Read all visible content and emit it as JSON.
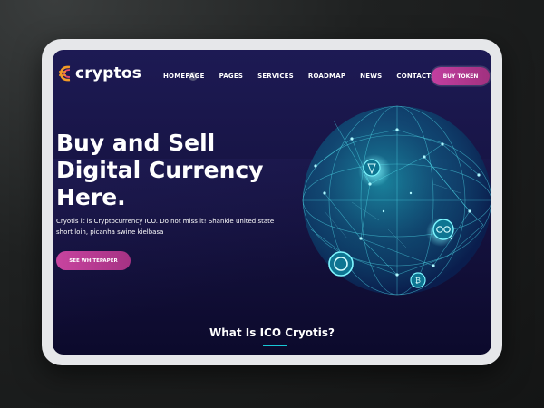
{
  "header": {
    "brand": "cryptos",
    "nav": [
      "HOMEPAGE",
      "PAGES",
      "SERVICES",
      "ROADMAP",
      "NEWS",
      "CONTACTS"
    ],
    "cta": "BUY TOKEN"
  },
  "hero": {
    "title_lines": [
      "Buy and Sell",
      "Digital Currency",
      "Here."
    ],
    "description": "Cryotis it is Cryptocurrency ICO. Do not miss it! Shankle united state short loin, picanha swine kielbasa",
    "button": "SEE WHITEPAPER"
  },
  "section": {
    "title": "What Is ICO Cryotis?"
  },
  "colors": {
    "background": "#1d1a54",
    "accent": "#c23fa0",
    "highlight": "#18c7d6"
  }
}
